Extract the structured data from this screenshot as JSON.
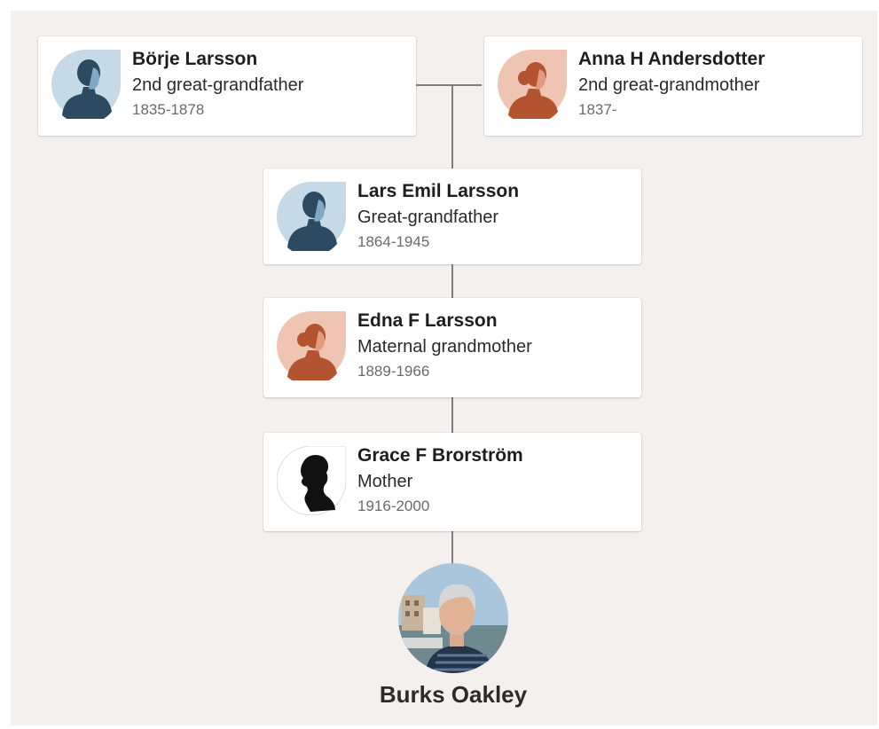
{
  "tree": {
    "people": [
      {
        "name": "Börje Larsson",
        "relation": "2nd great-grandfather",
        "dates": "1835-1878",
        "avatar": "male-silhouette-icon"
      },
      {
        "name": "Anna H Andersdotter",
        "relation": "2nd great-grandmother",
        "dates": "1837-",
        "avatar": "female-silhouette-icon"
      },
      {
        "name": "Lars Emil Larsson",
        "relation": "Great-grandfather",
        "dates": "1864-1945",
        "avatar": "male-silhouette-icon"
      },
      {
        "name": "Edna F Larsson",
        "relation": "Maternal grandmother",
        "dates": "1889-1966",
        "avatar": "female-silhouette-icon"
      },
      {
        "name": "Grace F Brorström",
        "relation": "Mother",
        "dates": "1916-2000",
        "avatar": "black-cameo-silhouette"
      }
    ],
    "focus_person": {
      "name": "Burks Oakley",
      "avatar": "profile-photo"
    }
  },
  "colors": {
    "background": "#f3f0ed",
    "male_avatar_bg": "#c5d9e7",
    "male_avatar_fg": "#2d4a63",
    "female_avatar_bg": "#efc4b2",
    "female_avatar_fg": "#b4532f",
    "connector": "#7d7d7d"
  }
}
